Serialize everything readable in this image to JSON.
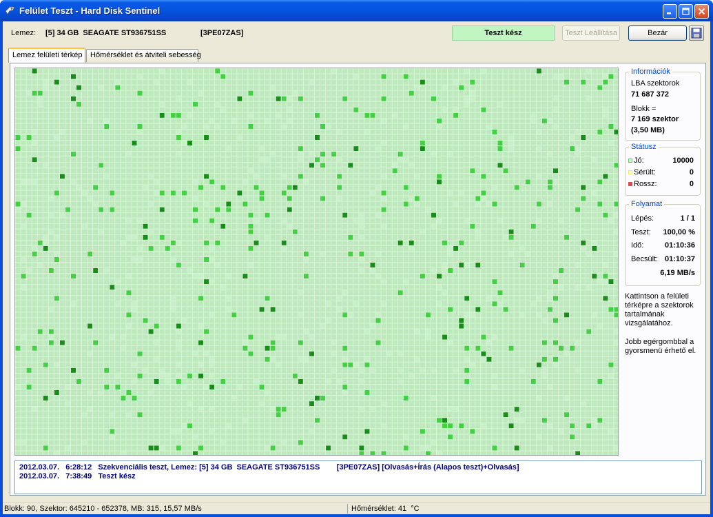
{
  "window": {
    "title": "Felület Teszt - Hard Disk Sentinel",
    "icon": "app-icon",
    "buttons": [
      "minimize-icon",
      "maximize-icon",
      "close-icon"
    ]
  },
  "toolbar": {
    "disk_label": "Lemez:",
    "disk_value": "[5] 34 GB  SEAGATE ST936751SS",
    "disk_serial": "[3PE07ZAS]",
    "status_text": "Teszt kész",
    "status_color": "#c1f5c1",
    "stop_label": "Teszt Leállítása",
    "close_label": "Bezár",
    "save_icon": "floppy-disk-icon"
  },
  "tabs": [
    {
      "label": "Lemez felületi térkép",
      "active": true
    },
    {
      "label": "Hőmérséklet és átviteli sebesség",
      "active": false
    }
  ],
  "surface_map": {
    "colors": {
      "base": "#bde9bd",
      "light": "#c8f0c8",
      "medium": "#45cf45",
      "dark": "#1a8c1a",
      "grid": "#d9f4d9"
    },
    "columns": 109,
    "rows": 70
  },
  "info": {
    "title": "Információk",
    "lba_label": "LBA szektorok",
    "lba_value": "71 687 372",
    "block_label": "Blokk =",
    "block_value": "7 169 szektor",
    "block_mb": "(3,50 MB)"
  },
  "status": {
    "title": "Státusz",
    "items": [
      {
        "label": "Jó:",
        "value": "10000",
        "color": "#6cc46c"
      },
      {
        "label": "Sérült:",
        "value": "0",
        "color": "#e8e870"
      },
      {
        "label": "Rossz:",
        "value": "0",
        "color": "#d05050"
      }
    ]
  },
  "progress": {
    "title": "Folyamat",
    "step_label": "Lépés:",
    "step_value": "1 / 1",
    "test_label": "Teszt:",
    "test_value": "100,00 %",
    "time_label": "Idő:",
    "time_value": "01:10:36",
    "est_label": "Becsült:",
    "est_value": "01:10:37",
    "speed_value": "6,19 MB/s"
  },
  "notes": {
    "note1": "Kattintson a felületi térképre a szektorok tartalmának vizsgálatához.",
    "note2": "Jobb egérgombbal a gyorsmenü érhető el."
  },
  "log": {
    "lines": [
      "2012.03.07.   6:28:12   Szekvenciális teszt, Lemez: [5] 34 GB  SEAGATE ST936751SS        [3PE07ZAS] [Olvasás+Írás (Alapos teszt)+Olvasás]",
      "2012.03.07.   7:38:49   Teszt kész"
    ]
  },
  "statusbar": {
    "left": "Blokk: 90, Szektor: 645210 - 652378, MB: 315, 15,57 MB/s",
    "right": "Hőmérséklet: 41  °C"
  }
}
